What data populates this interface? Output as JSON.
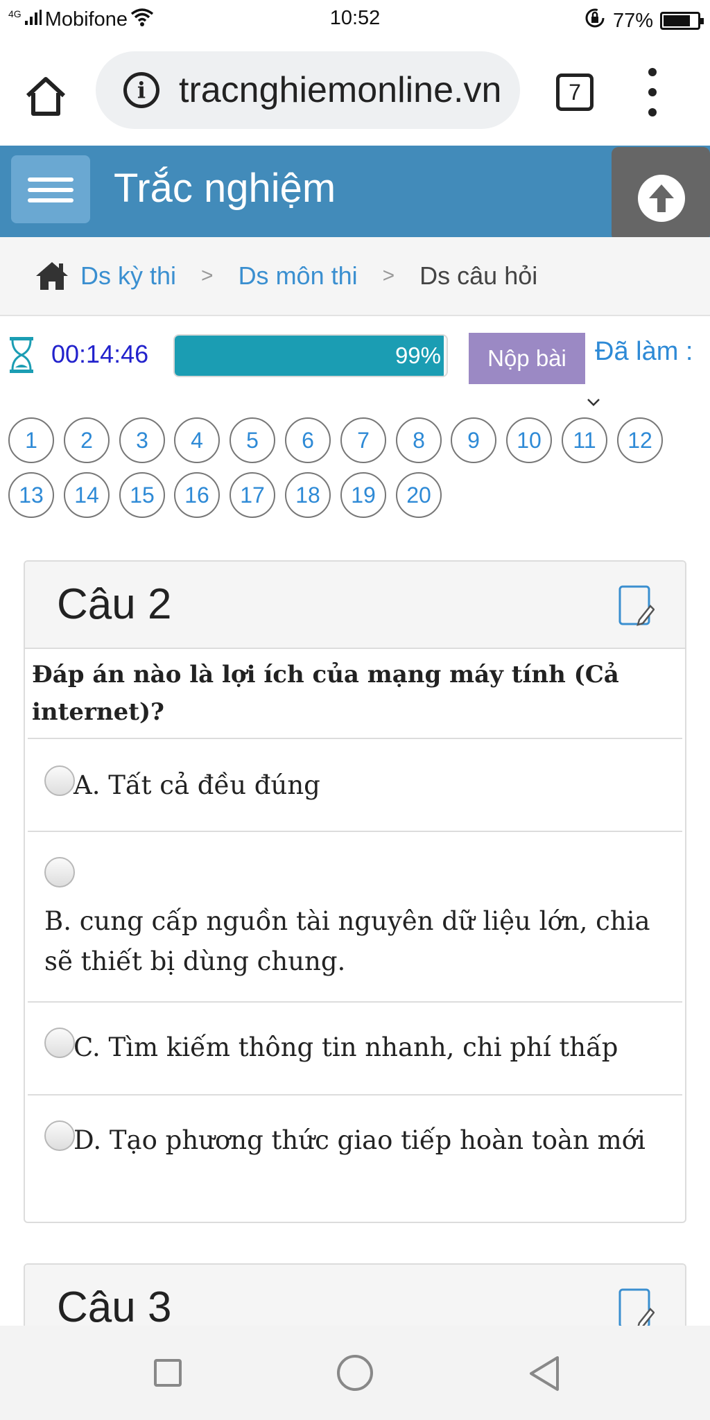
{
  "status_bar": {
    "network": "4G",
    "carrier": "Mobifone",
    "time": "10:52",
    "battery": "77%"
  },
  "browser": {
    "url": "tracnghiemonline.vn",
    "tab_count": "7"
  },
  "header": {
    "title": "Trắc nghiệm"
  },
  "breadcrumb": {
    "items": [
      "Ds kỳ thi",
      "Ds môn thi",
      "Ds câu hỏi"
    ],
    "separator": ">"
  },
  "quiz_bar": {
    "timer": "00:14:46",
    "progress_label": "99%",
    "progress_value": 0.99,
    "submit_label": "Nộp bài",
    "done_label": "Đã làm :"
  },
  "question_numbers": [
    "1",
    "2",
    "3",
    "4",
    "5",
    "6",
    "7",
    "8",
    "9",
    "10",
    "11",
    "12",
    "13",
    "14",
    "15",
    "16",
    "17",
    "18",
    "19",
    "20"
  ],
  "question_card": {
    "title": "Câu 2",
    "question": "Đáp án nào là lợi ích của mạng máy tính (Cả internet)?",
    "options": [
      "A. Tất cả đều đúng",
      "B. cung cấp nguồn tài nguyên dữ liệu lớn, chia sẽ thiết bị dùng chung.",
      "C. Tìm kiếm thông tin nhanh, chi phí thấp",
      "D. Tạo phương thức giao tiếp hoàn toàn mới"
    ]
  },
  "next_card": {
    "title": "Câu 3"
  },
  "colors": {
    "header": "#428bba",
    "progress": "#1b9db3",
    "submit": "#9b89c4",
    "link": "#3a8fd0",
    "timer": "#2222cc"
  },
  "icons": [
    "signal-icon",
    "wifi-icon",
    "rotation-lock-icon",
    "battery-icon",
    "home-icon",
    "info-icon",
    "more-vert-icon",
    "hamburger-icon",
    "arrow-up-icon",
    "house-icon",
    "hourglass-icon",
    "chevron-down-icon",
    "note-edit-icon",
    "nav-recents-icon",
    "nav-home-icon",
    "nav-back-icon"
  ]
}
